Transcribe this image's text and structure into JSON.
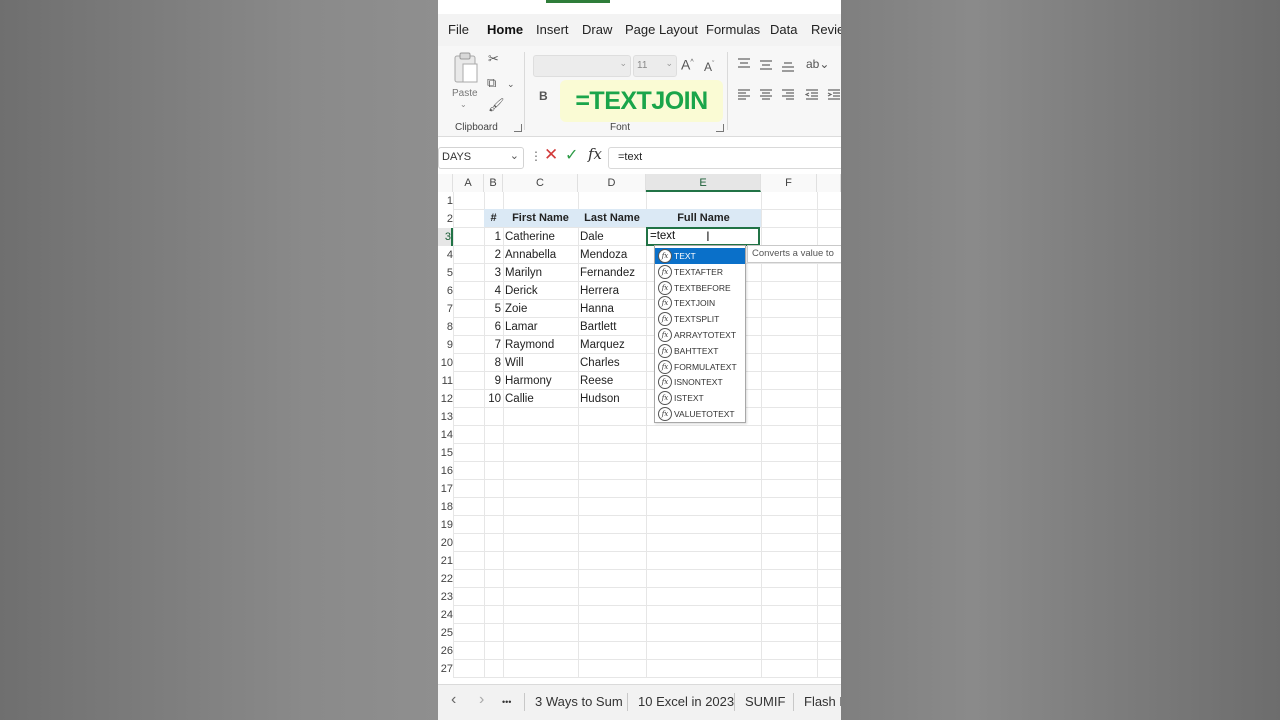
{
  "ribbon_tabs": [
    "File",
    "Home",
    "Insert",
    "Draw",
    "Page Layout",
    "Formulas",
    "Data",
    "Review"
  ],
  "active_tab": "Home",
  "clipboard": {
    "paste_label": "Paste",
    "group_label": "Clipboard"
  },
  "font": {
    "size_value": "11",
    "bold_label": "B",
    "group_label": "Font",
    "grow_label": "A",
    "shrink_label": "A"
  },
  "overlay_text": "=TEXTJOIN",
  "formula_bar": {
    "name_box": "DAYS",
    "dots": "⋮",
    "cancel": "✕",
    "enter": "✓",
    "fx": "fx",
    "formula": "=text"
  },
  "columns": [
    "A",
    "B",
    "C",
    "D",
    "E",
    "F"
  ],
  "selected_column": "E",
  "row_numbers": [
    "1",
    "2",
    "3",
    "4",
    "5",
    "6",
    "7",
    "8",
    "9",
    "10",
    "11",
    "12",
    "13",
    "14",
    "15",
    "16",
    "17",
    "18",
    "19",
    "20",
    "21",
    "22",
    "23",
    "24",
    "25",
    "26",
    "27"
  ],
  "selected_row": "3",
  "table": {
    "headers": [
      "#",
      "First Name",
      "Last Name",
      "Full Name"
    ],
    "rows": [
      {
        "n": "1",
        "first": "Catherine",
        "last": "Dale"
      },
      {
        "n": "2",
        "first": "Annabella",
        "last": "Mendoza"
      },
      {
        "n": "3",
        "first": "Marilyn",
        "last": "Fernandez"
      },
      {
        "n": "4",
        "first": "Derick",
        "last": "Herrera"
      },
      {
        "n": "5",
        "first": "Zoie",
        "last": "Hanna"
      },
      {
        "n": "6",
        "first": "Lamar",
        "last": "Bartlett"
      },
      {
        "n": "7",
        "first": "Raymond",
        "last": "Marquez"
      },
      {
        "n": "8",
        "first": "Will",
        "last": "Charles"
      },
      {
        "n": "9",
        "first": "Harmony",
        "last": "Reese"
      },
      {
        "n": "10",
        "first": "Callie",
        "last": "Hudson"
      }
    ]
  },
  "active_cell_text": "=text",
  "autocomplete": {
    "items": [
      "TEXT",
      "TEXTAFTER",
      "TEXTBEFORE",
      "TEXTJOIN",
      "TEXTSPLIT",
      "ARRAYTOTEXT",
      "BAHTTEXT",
      "FORMULATEXT",
      "ISNONTEXT",
      "ISTEXT",
      "VALUETOTEXT"
    ],
    "selected": "TEXT",
    "icon_label": "fx",
    "tooltip": "Converts a value to"
  },
  "sheet_tabs": [
    "3 Ways to Sum",
    "10 Excel in 2023",
    "SUMIF",
    "Flash F"
  ],
  "sheet_nav": {
    "prev": "‹",
    "next": "›",
    "more": "•••"
  },
  "colors": {
    "accent": "#217346",
    "overlay_text": "#1aa54a",
    "overlay_bg": "#fafbd4",
    "autocomplete_selected": "#0a70c9",
    "table_header_bg": "#dbe9f5"
  }
}
